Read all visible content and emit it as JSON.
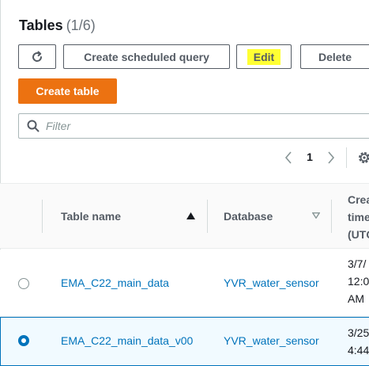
{
  "header": {
    "title": "Tables",
    "count": "(1/6)"
  },
  "toolbar": {
    "refresh_icon": "refresh-icon",
    "create_scheduled_query_label": "Create scheduled query",
    "edit_label": "Edit",
    "delete_label": "Delete",
    "create_table_label": "Create table",
    "accent_color": "#ec7211",
    "highlight_color": "#ffff33"
  },
  "filter": {
    "placeholder": "Filter",
    "value": "",
    "icon": "search-icon"
  },
  "pagination": {
    "current_page": "1",
    "prev_icon": "chevron-left-icon",
    "next_icon": "chevron-right-icon",
    "settings_icon": "gear-icon"
  },
  "table": {
    "columns": {
      "table_name": "Table name",
      "database": "Database",
      "created": "Crea\ntime\n(UTC"
    },
    "sort_icons": {
      "table_name": "sort-ascending-icon",
      "database": "sort-descending-icon"
    },
    "rows": [
      {
        "selected": false,
        "table_name": "EMA_C22_main_data",
        "database": "YVR_water_sensor",
        "created": "3/7/\n12:0\nAM"
      },
      {
        "selected": true,
        "table_name": "EMA_C22_main_data_v00",
        "database": "YVR_water_sensor",
        "created": "3/25\n4:44"
      }
    ],
    "link_color": "#0073bb",
    "selected_row_color": "#f1faff"
  }
}
